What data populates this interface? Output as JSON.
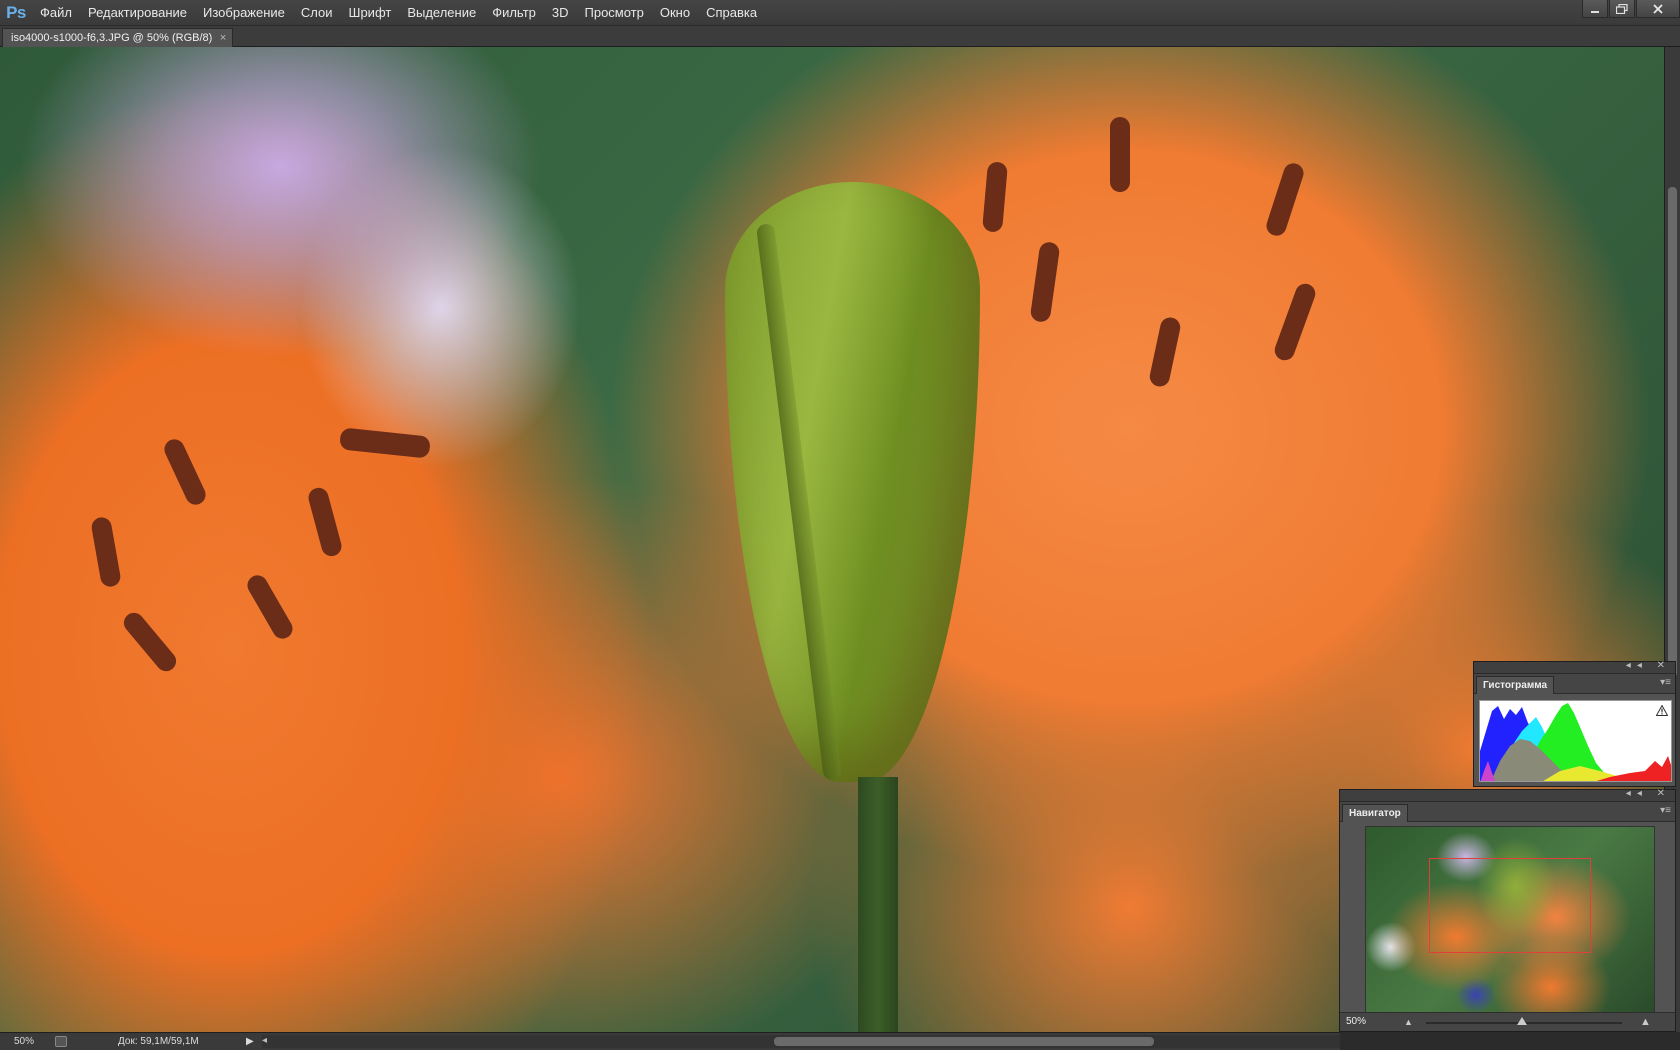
{
  "app": {
    "logo": "Ps"
  },
  "menu": [
    "Файл",
    "Редактирование",
    "Изображение",
    "Слои",
    "Шрифт",
    "Выделение",
    "Фильтр",
    "3D",
    "Просмотр",
    "Окно",
    "Справка"
  ],
  "window_controls": {
    "minimize_icon": "minimize-icon",
    "restore_icon": "restore-icon",
    "close_icon": "close-icon"
  },
  "document": {
    "tab_title": "iso4000-s1000-f6,3.JPG @ 50% (RGB/8)",
    "tab_close": "×"
  },
  "status": {
    "zoom": "50%",
    "doc_info": "Док: 59,1M/59,1M",
    "arrow": "▶",
    "scroll_left": "◂"
  },
  "panels": {
    "histogram": {
      "title": "Гистограмма",
      "warning_icon": "warning-icon",
      "collapse": "◂◂ ✕",
      "menu": "▾≡"
    },
    "navigator": {
      "title": "Навигатор",
      "zoom": "50%",
      "collapse": "◂◂ ✕",
      "menu": "▾≡",
      "zoom_out": "▲",
      "zoom_in": "▲",
      "zoom_level_fraction": 0.5
    }
  }
}
